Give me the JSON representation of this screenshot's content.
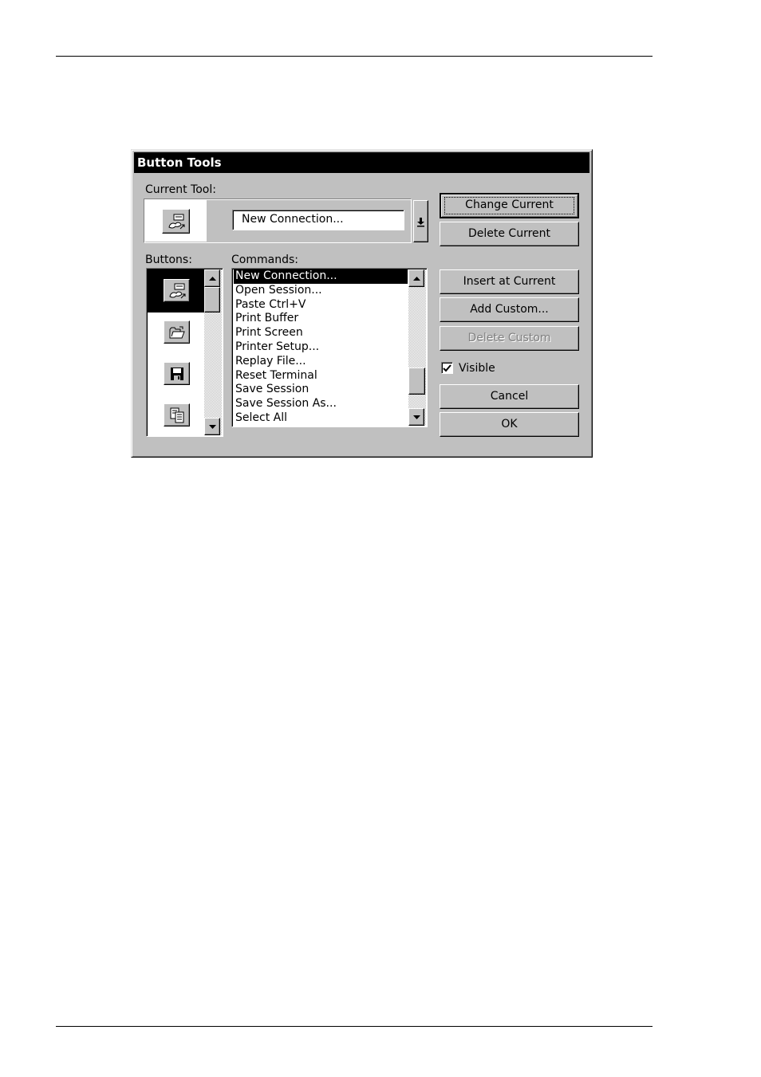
{
  "dialog": {
    "title": "Button Tools",
    "current_tool_label": "Current Tool:",
    "current_tool_value": "New Connection...",
    "buttons_label": "Buttons:",
    "commands_label": "Commands:",
    "visible_label": "Visible",
    "visible_checked": true,
    "button_icons": [
      "new-connection-icon",
      "open-folder-icon",
      "save-disk-icon",
      "copy-pages-icon"
    ],
    "commands": [
      "New Connection...",
      "Open Session...",
      "Paste  Ctrl+V",
      "Print Buffer",
      "Print Screen",
      "Printer Setup...",
      "Replay File...",
      "Reset Terminal",
      "Save Session",
      "Save Session As...",
      "Select All"
    ],
    "selected_command": "New Connection...",
    "buttons": {
      "change_current": "Change Current",
      "delete_current": "Delete Current",
      "insert_at_current": "Insert at Current",
      "add_custom": "Add Custom...",
      "delete_custom": "Delete Custom",
      "cancel": "Cancel",
      "ok": "OK"
    }
  }
}
